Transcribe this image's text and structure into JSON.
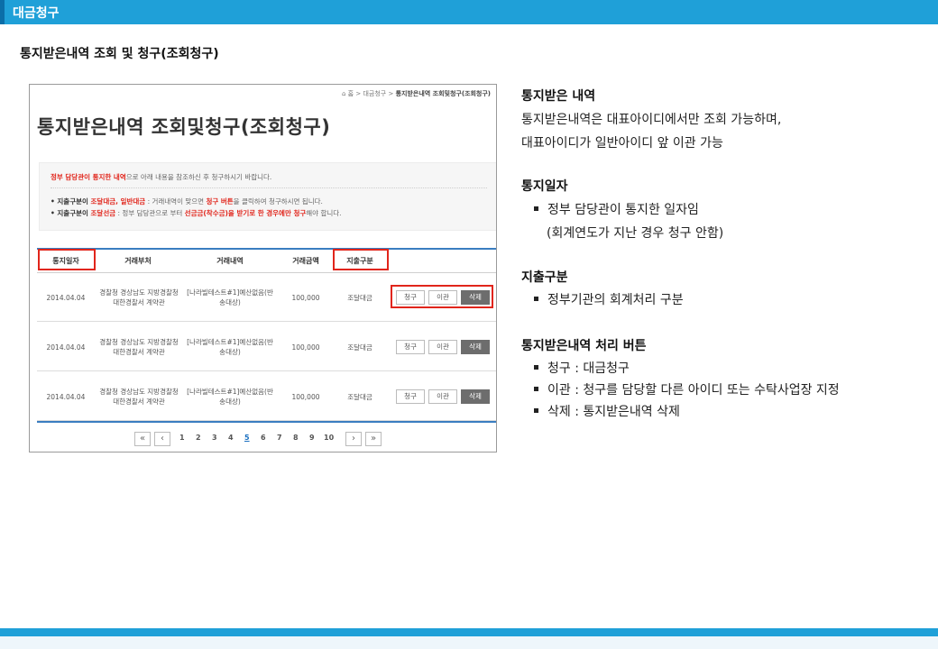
{
  "header": {
    "title": "대금청구"
  },
  "subtitle": "통지받은내역 조회 및 청구(조회청구)",
  "screenshot": {
    "breadcrumb": {
      "home": "홈",
      "level1": "대금청구",
      "level2": "통지받은내역 조회및청구(조회청구)",
      "sep": ">"
    },
    "page_title": "통지받은내역 조회및청구(조회청구)",
    "notice": {
      "line1_red": "정부 담당관이 통지한 내역",
      "line1_rest": "으로 아래 내용을 참조하신 후 청구하시기 바랍니다.",
      "line2_a": "• 지출구분이 ",
      "line2_b": "조달대금, 일반대금",
      "line2_c": " : 거래내역이 맞으면 ",
      "line2_d": "청구 버튼",
      "line2_e": "을 클릭하여 청구하시면 됩니다.",
      "line3_a": "• 지출구분이 ",
      "line3_b": "조달선금",
      "line3_c": " : 정부 담당관으로 부터 ",
      "line3_d": "선금금(착수금)을 받기로 한 경우에만 청구",
      "line3_e": "해야 합니다."
    },
    "table": {
      "columns": [
        "통지일자",
        "거래부처",
        "거래내역",
        "거래금액",
        "지출구분"
      ],
      "rows": [
        {
          "date": "2014.04.04",
          "agency": "경찰청 경상남도 지방경찰청 대한경찰서 계약관",
          "detail": "[나라빌테스트#1]예산없음(반송대상)",
          "amount": "100,000",
          "type": "조달대금"
        },
        {
          "date": "2014.04.04",
          "agency": "경찰청 경상남도 지방경찰청 대한경찰서 계약관",
          "detail": "[나라빌테스트#1]예산없음(반송대상)",
          "amount": "100,000",
          "type": "조달대금"
        },
        {
          "date": "2014.04.04",
          "agency": "경찰청 경상남도 지방경찰청 대한경찰서 계약관",
          "detail": "[나라빌테스트#1]예산없음(반송대상)",
          "amount": "100,000",
          "type": "조달대금"
        }
      ],
      "buttons": {
        "claim": "청구",
        "transfer": "이관",
        "delete": "삭제"
      }
    },
    "pagination": {
      "first": "«",
      "prev": "‹",
      "next": "›",
      "last": "»",
      "pages": [
        "1",
        "2",
        "3",
        "4",
        "5",
        "6",
        "7",
        "8",
        "9",
        "10"
      ],
      "current": "5"
    }
  },
  "notes": {
    "s1_title": "통지받은 내역",
    "s1_line1": "통지받은내역은 대표아이디에서만 조회 가능하며,",
    "s1_line2": "대표아이디가 일반아이디 앞 이관 가능",
    "s2_title": "통지일자",
    "s2_bullet1": "정부 담당관이 통지한 일자임",
    "s2_line2": "(회계연도가 지난 경우 청구 안함)",
    "s3_title": "지출구분",
    "s3_bullet1": "정부기관의 회계처리 구분",
    "s4_title": "통지받은내역 처리 버튼",
    "s4_bullet1": "청구 : 대금청구",
    "s4_bullet2": "이관 : 청구를 담당할 다른 아이디 또는 수탁사업장 지정",
    "s4_bullet3": "삭제 : 통지받은내역 삭제"
  }
}
